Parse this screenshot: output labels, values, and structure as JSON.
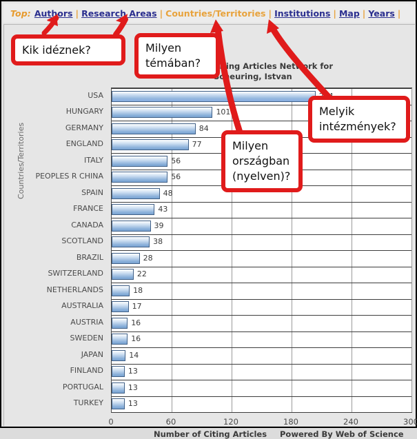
{
  "nav": {
    "prefix": "Top:",
    "items": [
      {
        "label": "Authors",
        "current": false
      },
      {
        "label": "Research Areas",
        "current": false
      },
      {
        "label": "Countries/Territories",
        "current": true
      },
      {
        "label": "Institutions",
        "current": false
      },
      {
        "label": "Map",
        "current": false
      },
      {
        "label": "Years",
        "current": false
      }
    ],
    "separator": "|"
  },
  "chart_data": {
    "type": "bar",
    "orientation": "horizontal",
    "title": "Citing Articles Network for Scheuring, Istvan",
    "title_line1": "Citing Articles Network for",
    "title_line2": "Scheuring, Istvan",
    "xlabel": "Number of Citing Articles",
    "ylabel": "Countries/Territories",
    "xlim": [
      0,
      300
    ],
    "xticks": [
      0,
      60,
      120,
      180,
      240,
      300
    ],
    "grid": true,
    "legend": "none",
    "footer": "Powered By Web of Science",
    "categories": [
      "USA",
      "HUNGARY",
      "GERMANY",
      "ENGLAND",
      "ITALY",
      "PEOPLES R CHINA",
      "SPAIN",
      "FRANCE",
      "CANADA",
      "SCOTLAND",
      "BRAZIL",
      "SWITZERLAND",
      "NETHERLANDS",
      "AUSTRALIA",
      "AUSTRIA",
      "SWEDEN",
      "JAPAN",
      "FINLAND",
      "PORTUGAL",
      "TURKEY"
    ],
    "values": [
      204,
      101,
      84,
      77,
      56,
      56,
      48,
      43,
      39,
      38,
      28,
      22,
      18,
      17,
      16,
      16,
      14,
      13,
      13,
      13
    ],
    "bar_color": "#8ab0da",
    "bar_border": "#3f5f86"
  },
  "callouts": [
    {
      "id": "who-cites",
      "lines": [
        "Kik idéznek?"
      ]
    },
    {
      "id": "what-topic",
      "lines": [
        "Milyen",
        "témában?"
      ]
    },
    {
      "id": "what-country",
      "lines": [
        "Milyen",
        "országban",
        "(nyelven)?"
      ]
    },
    {
      "id": "what-inst",
      "lines": [
        "Melyik",
        "intézmények?"
      ]
    }
  ],
  "colors": {
    "callout_border": "#e01b1b",
    "nav_link": "#2b2f8f",
    "nav_current": "#e8a33d"
  }
}
